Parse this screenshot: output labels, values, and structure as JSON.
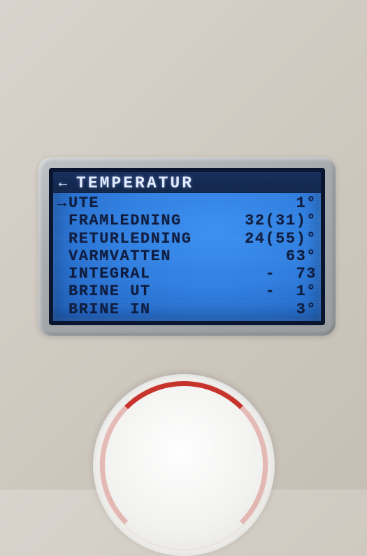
{
  "header": {
    "back_arrow": "←",
    "title": "TEMPERATUR"
  },
  "rows": [
    {
      "selected": true,
      "label": "UTE",
      "value": "1°"
    },
    {
      "selected": false,
      "label": "FRAMLEDNING",
      "value": "32(31)°"
    },
    {
      "selected": false,
      "label": "RETURLEDNING",
      "value": "24(55)°"
    },
    {
      "selected": false,
      "label": "VARMVATTEN",
      "value": "63°"
    },
    {
      "selected": false,
      "label": "INTEGRAL",
      "value": "-  73"
    },
    {
      "selected": false,
      "label": "BRINE UT",
      "value": "-  1°"
    },
    {
      "selected": false,
      "label": "BRINE IN",
      "value": "3°"
    }
  ],
  "cursor_glyph": "→"
}
